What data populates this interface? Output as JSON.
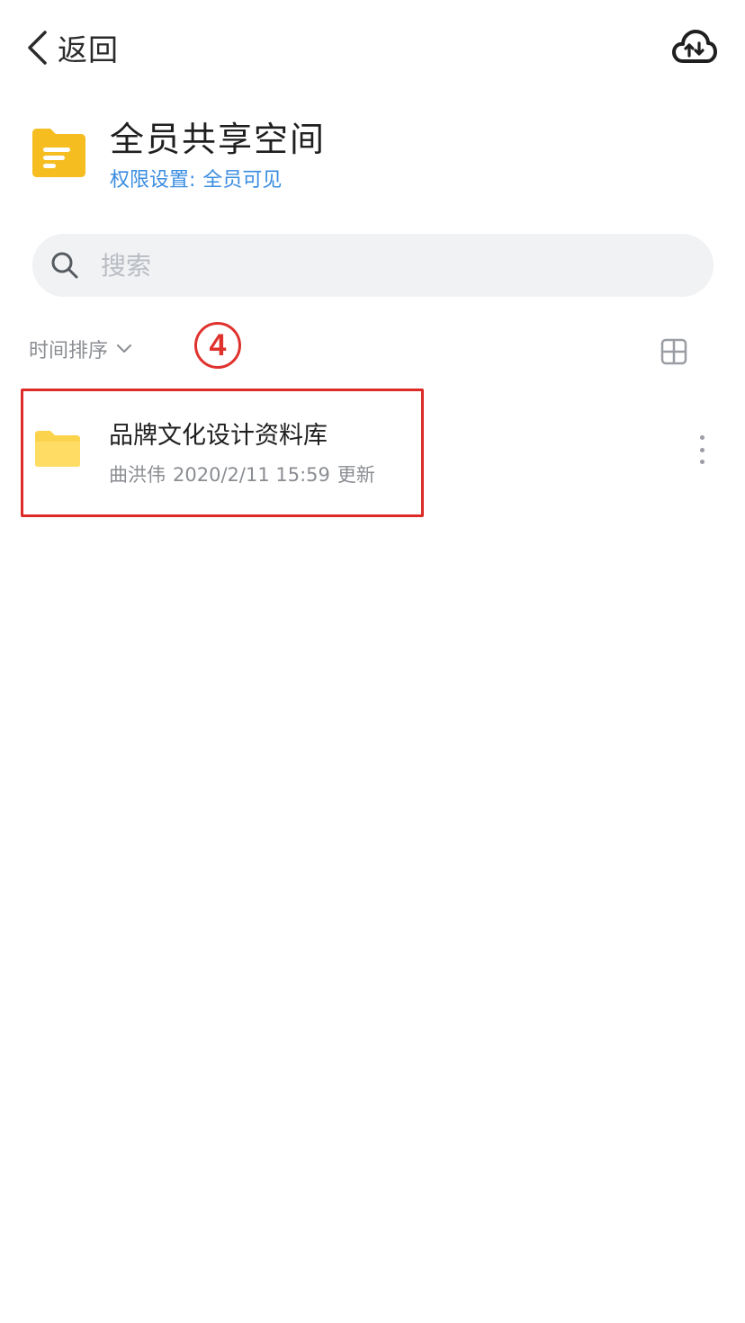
{
  "header": {
    "back_label": "返回",
    "cloud_icon": "cloud-transfer-icon"
  },
  "space": {
    "title": "全员共享空间",
    "permission_label": "权限设置:",
    "permission_value": "全员可见",
    "icon": "shared-space-folder-icon",
    "icon_color": "#f5bd1f",
    "link_color": "#3a8de0"
  },
  "search": {
    "placeholder": "搜索",
    "value": ""
  },
  "toolbar": {
    "sort_label": "时间排序",
    "step_marker": "4",
    "grid_icon": "grid-view-icon"
  },
  "files": [
    {
      "name": "品牌文化设计资料库",
      "owner": "曲洪伟",
      "updated": "2020/2/11 15:59",
      "updated_suffix": "更新",
      "icon": "folder-icon",
      "icon_color": "#fcd34d"
    }
  ],
  "annotation": {
    "highlight_color": "#dd2b27"
  }
}
